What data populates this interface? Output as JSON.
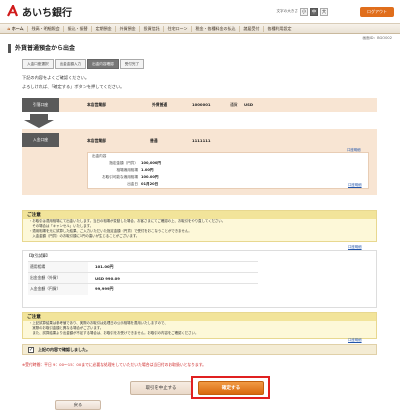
{
  "header": {
    "bank_name": "あいち銀行",
    "font_size_label": "文字の大きさ",
    "font_sizes": [
      "小",
      "中",
      "大"
    ],
    "logout": "ログアウト"
  },
  "nav": {
    "items": [
      "ホーム",
      "残高・明細照会",
      "振込・振替",
      "定期預金",
      "外貨預金",
      "投資信託",
      "住宅ローン",
      "税金・各種料金の払込",
      "諸届受付",
      "各種利用設定"
    ]
  },
  "screen_id": "画面ID：BGO002",
  "page_title": "外貨普通預金から出金",
  "steps": [
    "入金口座選択",
    "出金金額入力",
    "出金内容確認",
    "受付完了"
  ],
  "messages": {
    "line1": "下記の内容をよくご確認ください。",
    "line2": "よろしければ、「確定する」ボタンを押してください。"
  },
  "withdraw": {
    "label": "引落口座",
    "branch": "本店営業部",
    "type": "外貨普通",
    "account": "1000001",
    "currency_label": "通貨",
    "currency": "USD"
  },
  "deposit": {
    "label": "入金口座",
    "branch": "本店営業部",
    "type": "普通",
    "account": "1111111",
    "detail_link": "口座明細"
  },
  "balances": {
    "title": "出金内容",
    "rows": [
      {
        "label": "指定金額（円貨）",
        "value": "100,000円"
      },
      {
        "label": "相場適用相場",
        "value": "1.00円"
      },
      {
        "label": "お取引可能な適用相場",
        "value": "100.00円"
      },
      {
        "label": "出金日",
        "value": "01月20日"
      }
    ],
    "link": "口座明細"
  },
  "notice1": {
    "title": "ご注意",
    "lines": [
      "・お取引は適用相場にて出金いたします。当日の相場が変動した場合、お客さまにてご確認の上、お取引をやり直してください。",
      "　その場合は「キャンセル」いたします。",
      "・適用相場を元に試算した結果、ご入力いただいた指定金額（円貨）で受付をおこなうことができません。",
      "　入金金額（円貨）のお取引額に1円の違いが生じることがございます。"
    ],
    "link": "口座明細"
  },
  "details": {
    "title": "【取引試算】",
    "rows": [
      {
        "label": "適用相場",
        "value": "101.00円"
      },
      {
        "label": "出金金額（外貨）",
        "value": "USD 990.09"
      },
      {
        "label": "入金金額（円貨）",
        "value": "99,999円"
      }
    ]
  },
  "notice2": {
    "title": "ご注意",
    "lines": [
      "・上記試算結果は参考値であり、実際のお取引は処理日の公示相場を適用いたしますので、",
      "　実際のお取引金額と異なる場合がございます。",
      "　また、試算結果より出金額が不足する場合は、お取引をお受けできません。お取引の内容をご確認ください。"
    ],
    "link": "口座明細"
  },
  "confirm": {
    "label": "上記の内容で確認しました。"
  },
  "warning": "※受付時間：平日 9：00～15：00までに必要な処理をしていただいた場合は当日付のお取扱いとなります。",
  "buttons": {
    "cancel": "取引を中止する",
    "ok": "確定する",
    "back": "戻る"
  }
}
